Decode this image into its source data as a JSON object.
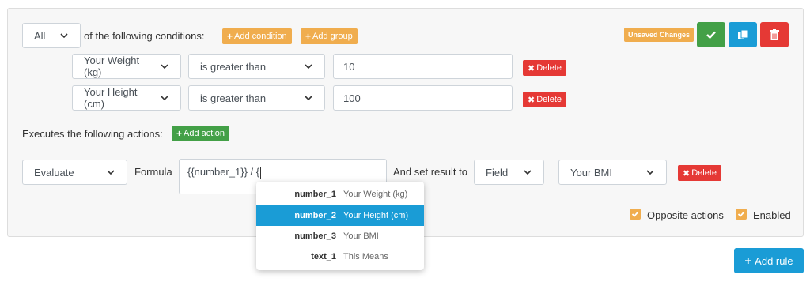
{
  "conditions_header": {
    "match_select": "All",
    "label": "of the following conditions:",
    "add_condition": "Add condition",
    "add_group": "Add group",
    "unsaved_badge": "Unsaved Changes"
  },
  "conditions": [
    {
      "field": "Your Weight (kg)",
      "operator": "is greater than",
      "value": "10",
      "delete": "Delete"
    },
    {
      "field": "Your Height (cm)",
      "operator": "is greater than",
      "value": "100",
      "delete": "Delete"
    }
  ],
  "actions_header": {
    "label": "Executes the following actions:",
    "add_action": "Add action"
  },
  "action": {
    "type_select": "Evaluate",
    "formula_label": "Formula",
    "formula_value": "{{number_1}} / {",
    "set_result_label": "And set result to",
    "target_type_select": "Field",
    "target_select": "Your BMI",
    "delete": "Delete"
  },
  "autocomplete": [
    {
      "key": "number_1",
      "label": "Your Weight (kg)",
      "active": false
    },
    {
      "key": "number_2",
      "label": "Your Height (cm)",
      "active": true
    },
    {
      "key": "number_3",
      "label": "Your BMI",
      "active": false
    },
    {
      "key": "text_1",
      "label": "This Means",
      "active": false
    }
  ],
  "options": {
    "opposite_actions": "Opposite actions",
    "enabled": "Enabled"
  },
  "footer": {
    "add_rule": "Add rule"
  },
  "colors": {
    "orange": "#f0ad4e",
    "green": "#43a047",
    "blue": "#1a9cd6",
    "red": "#e53935"
  }
}
